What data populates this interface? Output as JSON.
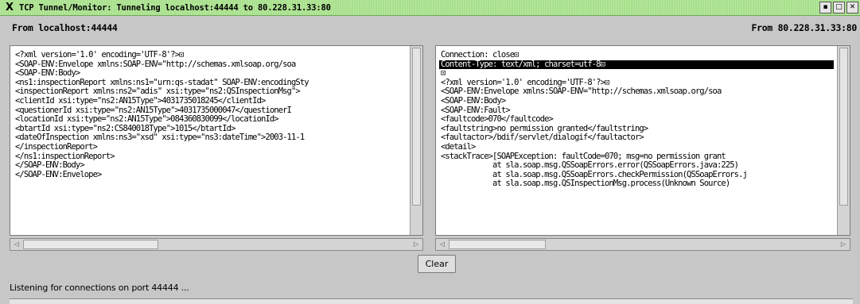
{
  "window": {
    "title": "TCP Tunnel/Monitor: Tunneling localhost:44444 to 80.228.31.33:80",
    "buttons": {
      "minimize": "▪",
      "maximize": "□",
      "close": "✕"
    }
  },
  "header": {
    "left": "From localhost:44444",
    "right": "From 80.228.31.33:80"
  },
  "left_pane": {
    "lines": [
      "<?xml version='1.0' encoding='UTF-8'?>⊡",
      "<SOAP-ENV:Envelope xmlns:SOAP-ENV=\"http://schemas.xmlsoap.org/soa",
      "<SOAP-ENV:Body>",
      "<ns1:inspectionReport xmlns:ns1=\"urn:qs-stadat\" SOAP-ENV:encodingSty",
      "<inspectionReport xmlns:ns2=\"adis\" xsi:type=\"ns2:QSInspectionMsg\">",
      "<clientId xsi:type=\"ns2:AN15Type\">4031735018245</clientId>",
      "<questionerId xsi:type=\"ns2:AN15Type\">4031735000047</questionerI",
      "<locationId xsi:type=\"ns2:AN15Type\">084360830099</locationId>",
      "<btartId xsi:type=\"ns2:CS840018Type\">1015</btartId>",
      "<dateOfInspection xmlns:ns3=\"xsd\" xsi:type=\"ns3:dateTime\">2003-11-1",
      "</inspectionReport>",
      "</ns1:inspectionReport>",
      "</SOAP-ENV:Body>",
      "</SOAP-ENV:Envelope>"
    ]
  },
  "right_pane": {
    "highlighted_index": 1,
    "lines": [
      "Connection: close⊡",
      "Content-Type: text/xml; charset=utf-8⊡",
      "⊡",
      "<?xml version='1.0' encoding='UTF-8'?>⊡",
      "<SOAP-ENV:Envelope xmlns:SOAP-ENV=\"http://schemas.xmlsoap.org/soa",
      "<SOAP-ENV:Body>",
      "<SOAP-ENV:Fault>",
      "<faultcode>070</faultcode>",
      "<faultstring>no permission granted</faultstring>",
      "<faultactor>/bdif/servlet/dialogif</faultactor>",
      "<detail>",
      "<stackTrace>[SOAPException: faultCode=070; msg=no permission grant",
      "            at sla.soap.msg.QSSoapErrors.error(QSSoapErrors.java:225)",
      "            at sla.soap.msg.QSSoapErrors.checkPermission(QSSoapErrors.j",
      "            at sla.soap.msg.QSInspectionMsg.process(Unknown Source)"
    ]
  },
  "scroll": {
    "left_h_thumb": 0.35,
    "right_h_thumb": 0.25,
    "left_v_thumb": 0.85,
    "right_v_thumb": 0.85
  },
  "clear_label": "Clear",
  "status": "Listening for connections on port 44444 ..."
}
